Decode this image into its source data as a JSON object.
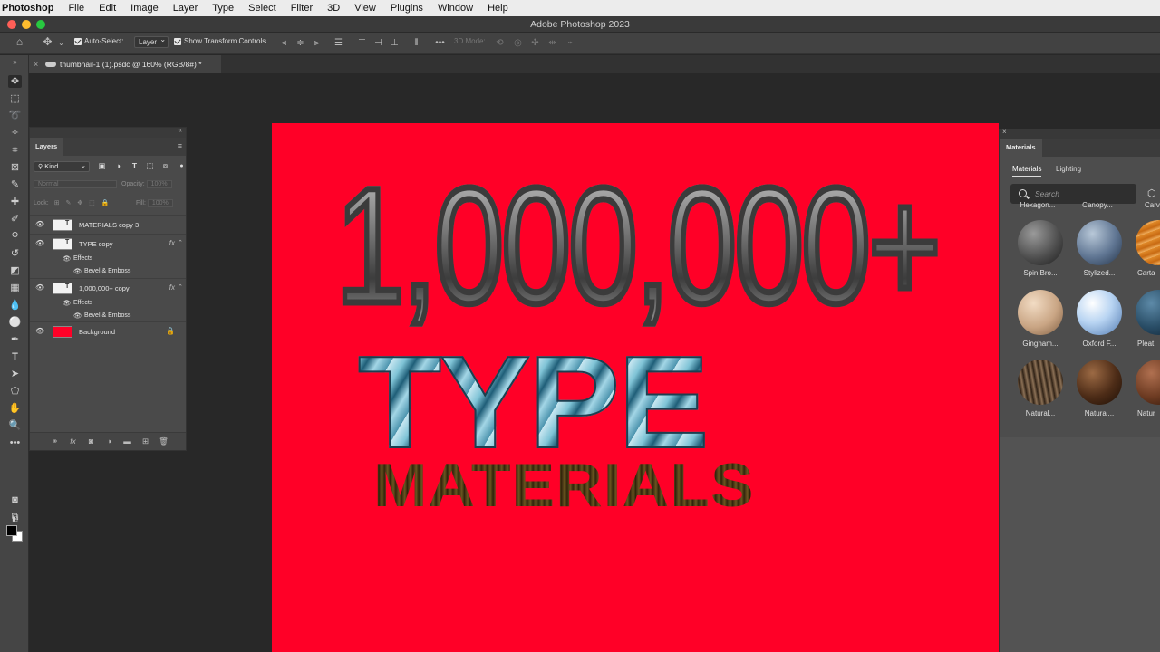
{
  "menubar": {
    "app": "Photoshop",
    "items": [
      "File",
      "Edit",
      "Image",
      "Layer",
      "Type",
      "Select",
      "Filter",
      "3D",
      "View",
      "Plugins",
      "Window",
      "Help"
    ]
  },
  "window": {
    "title": "Adobe Photoshop 2023"
  },
  "options": {
    "auto_select_label": "Auto-Select:",
    "auto_select_value": "Layer",
    "show_transform_label": "Show Transform Controls",
    "mode_3d_label": "3D Mode:"
  },
  "document_tab": {
    "label": "thumbnail-1 (1).psdc @ 160% (RGB/8#) *"
  },
  "canvas": {
    "bg_color": "#ff0027",
    "line1": "1,000,000+",
    "line2": "TYPE",
    "line3": "MATERIALS"
  },
  "layers_panel": {
    "title": "Layers",
    "filter_kind": "Kind",
    "blend_mode": "Normal",
    "opacity_label": "Opacity:",
    "opacity_value": "100%",
    "lock_label": "Lock:",
    "fill_label": "Fill:",
    "fill_value": "100%",
    "layers": [
      {
        "name": "MATERIALS copy 3"
      },
      {
        "name": "TYPE copy",
        "fx": "fx",
        "effects_label": "Effects",
        "effect": "Bevel & Emboss"
      },
      {
        "name": "1,000,000+ copy",
        "fx": "fx",
        "effects_label": "Effects",
        "effect": "Bevel & Emboss"
      },
      {
        "name": "Background",
        "thumb_color": "#ff0027"
      }
    ]
  },
  "materials_panel": {
    "title": "Materials",
    "tabs": [
      "Materials",
      "Lighting"
    ],
    "search_placeholder": "Search",
    "top_partial": [
      "Hexagon...",
      "Canopy...",
      "Carve..."
    ],
    "items": [
      "Spin Bro...",
      "Stylized...",
      "Carta",
      "Gingham...",
      "Oxford F...",
      "Pleat",
      "Natural...",
      "Natural...",
      "Natur"
    ]
  }
}
